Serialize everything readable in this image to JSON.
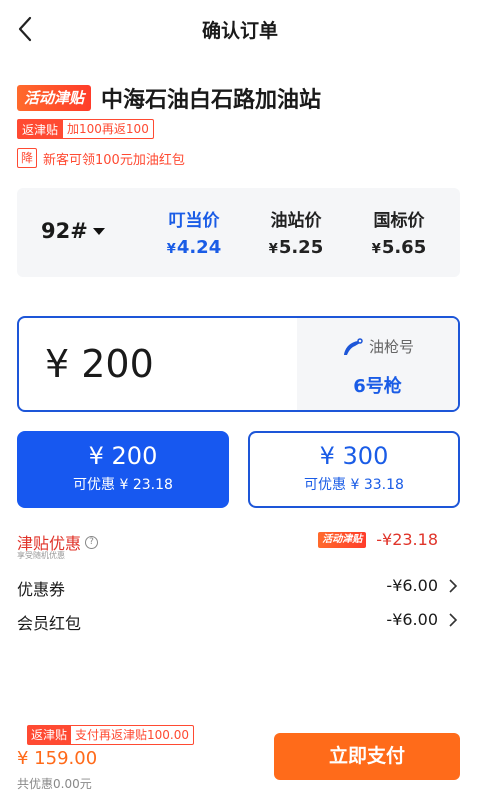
{
  "header": {
    "title": "确认订单"
  },
  "station": {
    "promo_tag": "活动津贴",
    "name": "中海石油白石路加油站",
    "rebate_tag": "返津贴",
    "rebate_desc": "加100再返100",
    "new_customer_badge": "降",
    "new_customer_text": "新客可领100元加油红包"
  },
  "prices": {
    "fuel_grade": "92#",
    "columns": [
      {
        "label": "叮当价",
        "currency": "¥",
        "value": "4.24"
      },
      {
        "label": "油站价",
        "currency": "¥",
        "value": "5.25"
      },
      {
        "label": "国标价",
        "currency": "¥",
        "value": "5.65"
      }
    ]
  },
  "amount_input": {
    "value": "¥ 200",
    "nozzle_label": "油枪号",
    "nozzle_value": "6号枪"
  },
  "quick_amounts": [
    {
      "amount": "¥ 200",
      "discount": "可优惠 ¥ 23.18",
      "selected": true
    },
    {
      "amount": "¥ 300",
      "discount": "可优惠 ¥ 33.18",
      "selected": false
    }
  ],
  "discounts": {
    "jintie_title": "津贴优惠",
    "jintie_sub": "享受随机优惠",
    "jintie_tag": "活动津贴",
    "jintie_amount": "-¥23.18",
    "coupon_label": "优惠券",
    "coupon_amount": "-¥6.00",
    "member_label": "会员红包",
    "member_amount": "-¥6.00"
  },
  "bottom": {
    "rebate_tag": "返津贴",
    "rebate_desc": "支付再返津贴100.00",
    "total": "¥ 159.00",
    "total_discount": "共优惠0.00元",
    "pay_label": "立即支付"
  },
  "colors": {
    "primary_blue": "#1758f0",
    "accent_orange": "#ff6b1a",
    "alert_red": "#ff4a32"
  }
}
